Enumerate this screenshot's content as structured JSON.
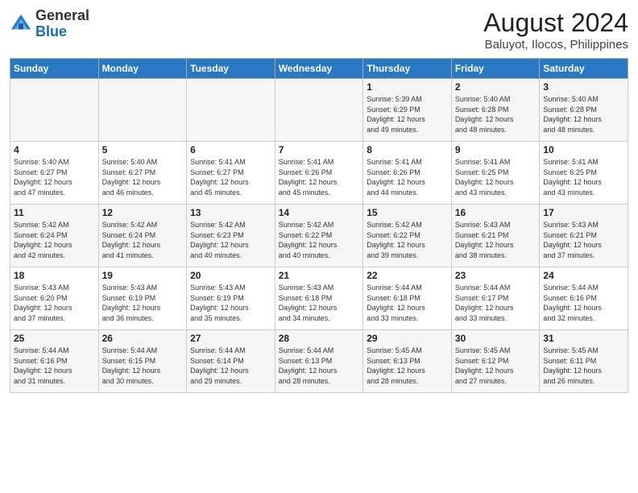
{
  "header": {
    "logo_general": "General",
    "logo_blue": "Blue",
    "month_year": "August 2024",
    "location": "Baluyot, Ilocos, Philippines"
  },
  "weekdays": [
    "Sunday",
    "Monday",
    "Tuesday",
    "Wednesday",
    "Thursday",
    "Friday",
    "Saturday"
  ],
  "weeks": [
    [
      {
        "day": "",
        "content": ""
      },
      {
        "day": "",
        "content": ""
      },
      {
        "day": "",
        "content": ""
      },
      {
        "day": "",
        "content": ""
      },
      {
        "day": "1",
        "content": "Sunrise: 5:39 AM\nSunset: 6:29 PM\nDaylight: 12 hours\nand 49 minutes."
      },
      {
        "day": "2",
        "content": "Sunrise: 5:40 AM\nSunset: 6:28 PM\nDaylight: 12 hours\nand 48 minutes."
      },
      {
        "day": "3",
        "content": "Sunrise: 5:40 AM\nSunset: 6:28 PM\nDaylight: 12 hours\nand 48 minutes."
      }
    ],
    [
      {
        "day": "4",
        "content": "Sunrise: 5:40 AM\nSunset: 6:27 PM\nDaylight: 12 hours\nand 47 minutes."
      },
      {
        "day": "5",
        "content": "Sunrise: 5:40 AM\nSunset: 6:27 PM\nDaylight: 12 hours\nand 46 minutes."
      },
      {
        "day": "6",
        "content": "Sunrise: 5:41 AM\nSunset: 6:27 PM\nDaylight: 12 hours\nand 45 minutes."
      },
      {
        "day": "7",
        "content": "Sunrise: 5:41 AM\nSunset: 6:26 PM\nDaylight: 12 hours\nand 45 minutes."
      },
      {
        "day": "8",
        "content": "Sunrise: 5:41 AM\nSunset: 6:26 PM\nDaylight: 12 hours\nand 44 minutes."
      },
      {
        "day": "9",
        "content": "Sunrise: 5:41 AM\nSunset: 6:25 PM\nDaylight: 12 hours\nand 43 minutes."
      },
      {
        "day": "10",
        "content": "Sunrise: 5:41 AM\nSunset: 6:25 PM\nDaylight: 12 hours\nand 43 minutes."
      }
    ],
    [
      {
        "day": "11",
        "content": "Sunrise: 5:42 AM\nSunset: 6:24 PM\nDaylight: 12 hours\nand 42 minutes."
      },
      {
        "day": "12",
        "content": "Sunrise: 5:42 AM\nSunset: 6:24 PM\nDaylight: 12 hours\nand 41 minutes."
      },
      {
        "day": "13",
        "content": "Sunrise: 5:42 AM\nSunset: 6:23 PM\nDaylight: 12 hours\nand 40 minutes."
      },
      {
        "day": "14",
        "content": "Sunrise: 5:42 AM\nSunset: 6:22 PM\nDaylight: 12 hours\nand 40 minutes."
      },
      {
        "day": "15",
        "content": "Sunrise: 5:42 AM\nSunset: 6:22 PM\nDaylight: 12 hours\nand 39 minutes."
      },
      {
        "day": "16",
        "content": "Sunrise: 5:43 AM\nSunset: 6:21 PM\nDaylight: 12 hours\nand 38 minutes."
      },
      {
        "day": "17",
        "content": "Sunrise: 5:43 AM\nSunset: 6:21 PM\nDaylight: 12 hours\nand 37 minutes."
      }
    ],
    [
      {
        "day": "18",
        "content": "Sunrise: 5:43 AM\nSunset: 6:20 PM\nDaylight: 12 hours\nand 37 minutes."
      },
      {
        "day": "19",
        "content": "Sunrise: 5:43 AM\nSunset: 6:19 PM\nDaylight: 12 hours\nand 36 minutes."
      },
      {
        "day": "20",
        "content": "Sunrise: 5:43 AM\nSunset: 6:19 PM\nDaylight: 12 hours\nand 35 minutes."
      },
      {
        "day": "21",
        "content": "Sunrise: 5:43 AM\nSunset: 6:18 PM\nDaylight: 12 hours\nand 34 minutes."
      },
      {
        "day": "22",
        "content": "Sunrise: 5:44 AM\nSunset: 6:18 PM\nDaylight: 12 hours\nand 33 minutes."
      },
      {
        "day": "23",
        "content": "Sunrise: 5:44 AM\nSunset: 6:17 PM\nDaylight: 12 hours\nand 33 minutes."
      },
      {
        "day": "24",
        "content": "Sunrise: 5:44 AM\nSunset: 6:16 PM\nDaylight: 12 hours\nand 32 minutes."
      }
    ],
    [
      {
        "day": "25",
        "content": "Sunrise: 5:44 AM\nSunset: 6:16 PM\nDaylight: 12 hours\nand 31 minutes."
      },
      {
        "day": "26",
        "content": "Sunrise: 5:44 AM\nSunset: 6:15 PM\nDaylight: 12 hours\nand 30 minutes."
      },
      {
        "day": "27",
        "content": "Sunrise: 5:44 AM\nSunset: 6:14 PM\nDaylight: 12 hours\nand 29 minutes."
      },
      {
        "day": "28",
        "content": "Sunrise: 5:44 AM\nSunset: 6:13 PM\nDaylight: 12 hours\nand 28 minutes."
      },
      {
        "day": "29",
        "content": "Sunrise: 5:45 AM\nSunset: 6:13 PM\nDaylight: 12 hours\nand 28 minutes."
      },
      {
        "day": "30",
        "content": "Sunrise: 5:45 AM\nSunset: 6:12 PM\nDaylight: 12 hours\nand 27 minutes."
      },
      {
        "day": "31",
        "content": "Sunrise: 5:45 AM\nSunset: 6:11 PM\nDaylight: 12 hours\nand 26 minutes."
      }
    ]
  ]
}
